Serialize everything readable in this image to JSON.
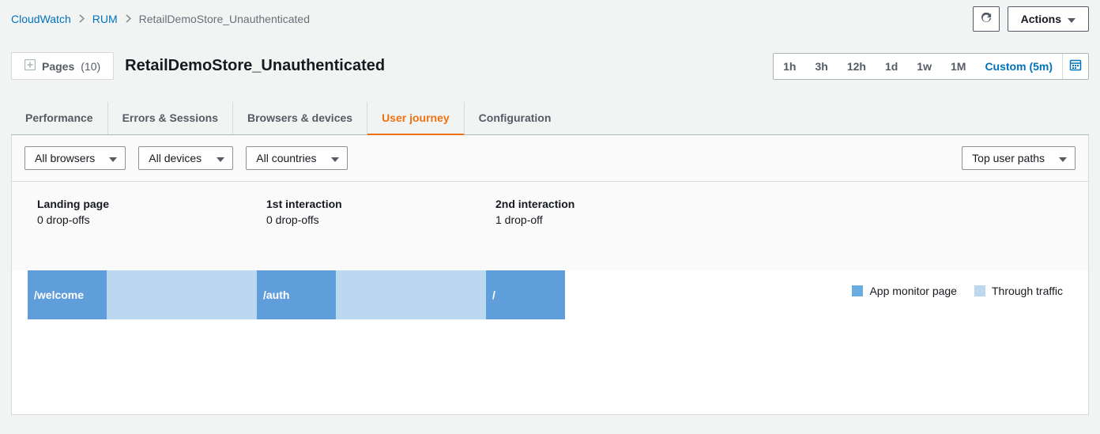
{
  "breadcrumb": {
    "root": "CloudWatch",
    "section": "RUM",
    "current": "RetailDemoStore_Unauthenticated"
  },
  "actions": {
    "actions_label": "Actions"
  },
  "pages": {
    "label": "Pages",
    "count": "(10)"
  },
  "title": "RetailDemoStore_Unauthenticated",
  "time_range": {
    "o0": "1h",
    "o1": "3h",
    "o2": "12h",
    "o3": "1d",
    "o4": "1w",
    "o5": "1M",
    "custom": "Custom (5m)"
  },
  "tabs": {
    "t0": "Performance",
    "t1": "Errors & Sessions",
    "t2": "Browsers & devices",
    "t3": "User journey",
    "t4": "Configuration"
  },
  "filters": {
    "browsers": "All browsers",
    "devices": "All devices",
    "countries": "All countries",
    "paths": "Top user paths"
  },
  "journey": {
    "steps": [
      {
        "title": "Landing page",
        "sub": "0 drop-offs"
      },
      {
        "title": "1st interaction",
        "sub": "0 drop-offs"
      },
      {
        "title": "2nd interaction",
        "sub": "1 drop-off"
      }
    ],
    "legend": {
      "app": "App monitor page",
      "through": "Through traffic"
    },
    "segments": {
      "s0": "/welcome",
      "s1": "/auth",
      "s2": "/"
    }
  }
}
